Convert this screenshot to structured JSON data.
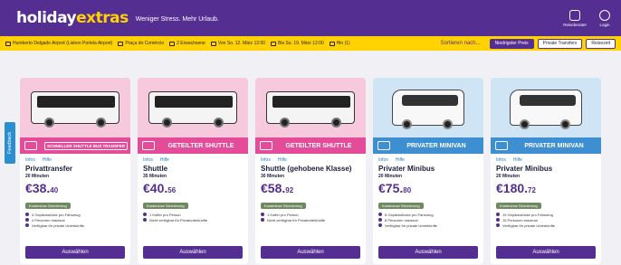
{
  "header": {
    "logo_part1": "holiday",
    "logo_part2": "extras",
    "tagline": "Weniger Stress. Mehr Urlaub.",
    "actions": [
      {
        "label": "Reiseberater",
        "icon": "chat-icon"
      },
      {
        "label": "Login",
        "icon": "user-icon"
      }
    ]
  },
  "search": {
    "items": [
      "Humberto Delgado Airport (Lisbon Portela Airport)",
      "Praça do Comércio",
      "2 Erwachsene",
      "Von So. 12. März 12:00",
      "Bis So. 19. März 12:00",
      "Hin (1)"
    ],
    "sort_label": "Sortieren nach...",
    "sort_options": [
      "Niedrigster Preis",
      "Private Transfers",
      "Reisezeit"
    ]
  },
  "feedback_label": "Feedback",
  "colors": {
    "brand_purple": "#542e91",
    "brand_yellow": "#ffd200",
    "shared_pink": "#e44c99",
    "private_blue": "#3d8fd1"
  },
  "cards": [
    {
      "banner": "SCHNELLER SHUTTLE BUS TRANSFER",
      "links": [
        "Infos",
        "Hilfe"
      ],
      "title": "Privattransfer",
      "duration": "20 Minuten",
      "price_main": "€38.",
      "price_cents": "40",
      "badge": "Kostenlose Stornierung",
      "features": [
        "4 Gepäckstücke pro Fahrzeug",
        "4 Personen maximal",
        "Verfügbar für private Unterkünfte"
      ],
      "button": "Auswählen"
    },
    {
      "banner": "GETEILTER SHUTTLE",
      "links": [
        "Infos",
        "Hilfe"
      ],
      "title": "Shuttle",
      "duration": "35 Minuten",
      "price_main": "€40.",
      "price_cents": "56",
      "badge": "Kostenlose Stornierung",
      "features": [
        "1 Koffer pro Person",
        "Nicht verfügbar für Privatunterkünfte"
      ],
      "button": "Auswählen"
    },
    {
      "banner": "GETEILTER SHUTTLE",
      "links": [
        "Infos",
        "Hilfe"
      ],
      "title": "Shuttle (gehobene Klasse)",
      "duration": "30 Minuten",
      "price_main": "€58.",
      "price_cents": "92",
      "badge": "Kostenlose Stornierung",
      "features": [
        "1 Koffer pro Person",
        "Nicht verfügbar für Privatunterkünfte"
      ],
      "button": "Auswählen"
    },
    {
      "banner": "PRIVATER MINIVAN",
      "links": [
        "Infos",
        "Hilfe"
      ],
      "title": "Privater Minibus",
      "duration": "20 Minuten",
      "price_main": "€75.",
      "price_cents": "80",
      "badge": "Kostenlose Stornierung",
      "features": [
        "8 Gepäckstücke pro Fahrzeug",
        "8 Personen maximal",
        "Verfügbar für private Unterkünfte"
      ],
      "button": "Auswählen"
    },
    {
      "banner": "PRIVATER MINIVAN",
      "links": [
        "Infos",
        "Hilfe"
      ],
      "title": "Privater Minibus",
      "duration": "20 Minuten",
      "price_main": "€180.",
      "price_cents": "72",
      "badge": "Kostenlose Stornierung",
      "features": [
        "15 Gepäckstücke pro Fahrzeug",
        "15 Personen maximal",
        "Verfügbar für private Unterkünfte"
      ],
      "button": "Auswählen"
    }
  ]
}
